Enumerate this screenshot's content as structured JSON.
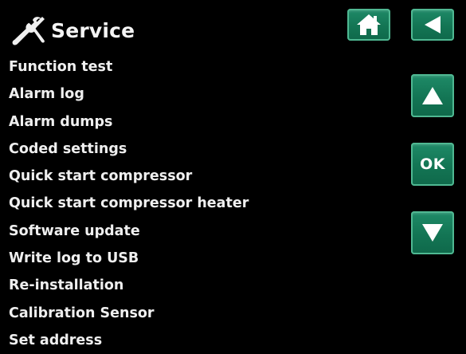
{
  "header": {
    "title": "Service",
    "icon": "tools-icon"
  },
  "menu": {
    "items": [
      {
        "label": "Function test"
      },
      {
        "label": "Alarm log"
      },
      {
        "label": "Alarm dumps"
      },
      {
        "label": "Coded settings"
      },
      {
        "label": "Quick start compressor"
      },
      {
        "label": "Quick start compressor heater"
      },
      {
        "label": "Software update"
      },
      {
        "label": "Write log to USB"
      },
      {
        "label": "Re-installation"
      },
      {
        "label": "Calibration Sensor"
      },
      {
        "label": "Set address"
      }
    ]
  },
  "nav": {
    "home_icon": "home-icon",
    "back_icon": "back-arrow-icon",
    "up_icon": "up-arrow-icon",
    "ok_label": "OK",
    "down_icon": "down-arrow-icon"
  },
  "colors": {
    "background": "#000000",
    "text": "#efefef",
    "button": "#137554",
    "button_border": "#4fb892",
    "icon": "#ffffff"
  }
}
